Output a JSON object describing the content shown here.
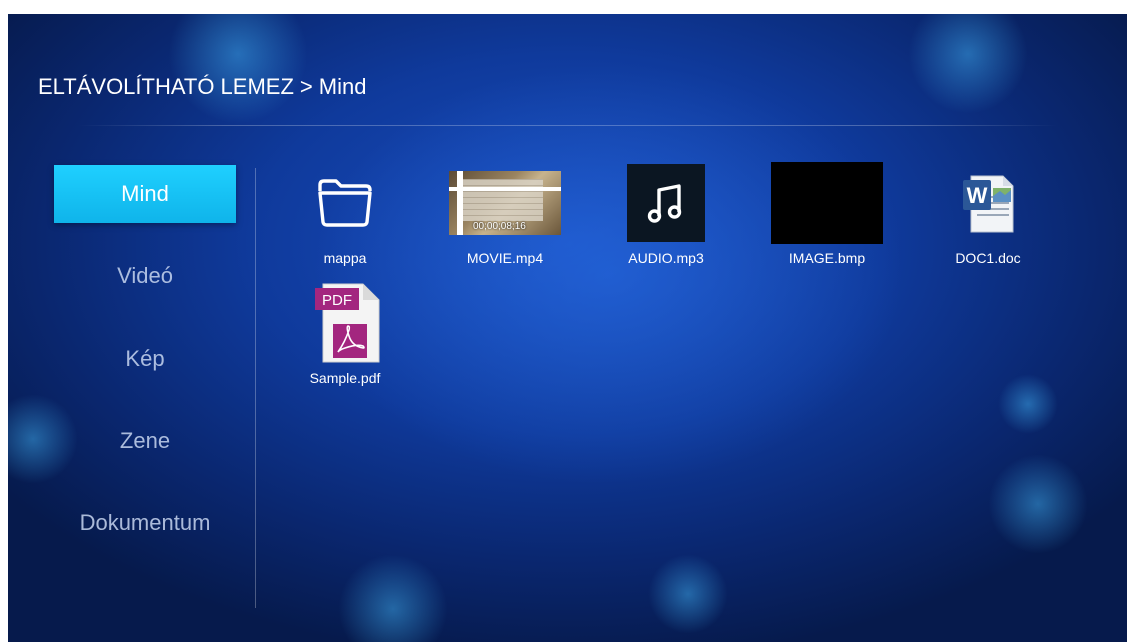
{
  "breadcrumb": {
    "root": "ELTÁVOLÍTHATÓ LEMEZ",
    "separator": ">",
    "current": "Mind"
  },
  "sidebar": {
    "items": [
      {
        "label": "Mind",
        "active": true
      },
      {
        "label": "Videó",
        "active": false
      },
      {
        "label": "Kép",
        "active": false
      },
      {
        "label": "Zene",
        "active": false
      },
      {
        "label": "Dokumentum",
        "active": false
      }
    ]
  },
  "files": [
    {
      "name": "mappa",
      "type": "folder",
      "icon": "folder-icon"
    },
    {
      "name": "MOVIE.mp4",
      "type": "video",
      "icon": "video-thumbnail",
      "timecode": "00;00;08;16"
    },
    {
      "name": "AUDIO.mp3",
      "type": "audio",
      "icon": "music-note-icon"
    },
    {
      "name": "IMAGE.bmp",
      "type": "image",
      "icon": "image-thumbnail"
    },
    {
      "name": "DOC1.doc",
      "type": "document",
      "icon": "word-doc-icon",
      "badge": "W"
    },
    {
      "name": "Sample.pdf",
      "type": "pdf",
      "icon": "pdf-icon",
      "badge": "PDF"
    }
  ],
  "colors": {
    "active_tab": "#1fc6f7",
    "background": "#0f3a9c",
    "word_blue": "#2b5797",
    "pdf_magenta": "#a3267f"
  }
}
